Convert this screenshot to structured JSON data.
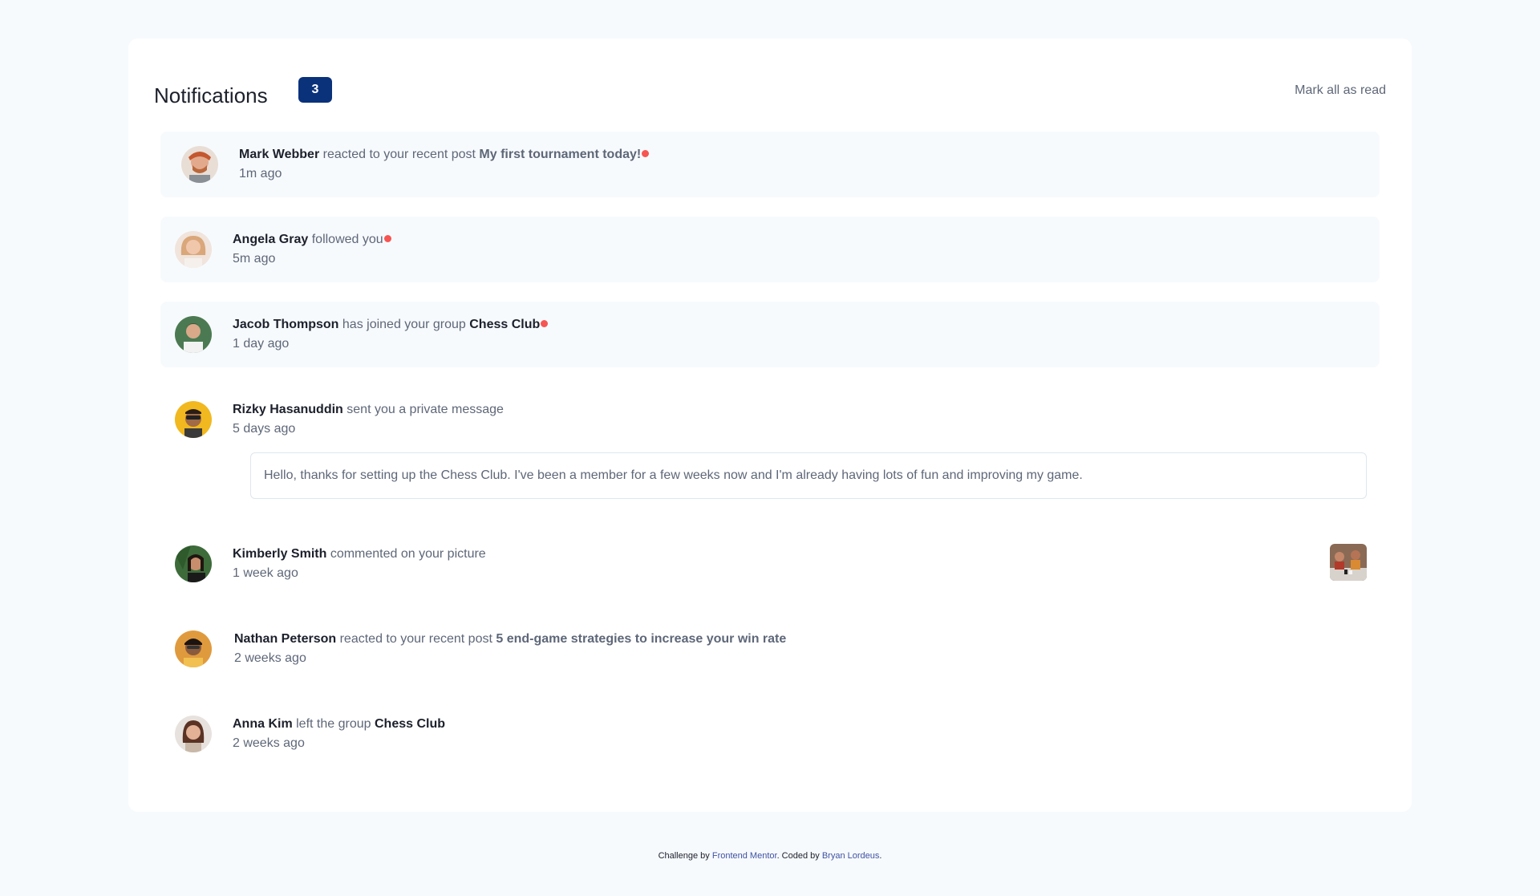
{
  "header": {
    "title": "Notifications",
    "unread_count": "3",
    "mark_all_label": "Mark all as read"
  },
  "notifications": [
    {
      "name": "Mark Webber",
      "action": "reacted to your recent post",
      "target": "My first tournament today!",
      "time": "1m ago",
      "unread": true,
      "avatar": "avatar-mark-webber"
    },
    {
      "name": "Angela Gray",
      "action": "followed you",
      "target": "",
      "time": "5m ago",
      "unread": true,
      "avatar": "avatar-angela-gray"
    },
    {
      "name": "Jacob Thompson",
      "action": "has joined your group",
      "target": "Chess Club",
      "time": "1 day ago",
      "unread": true,
      "avatar": "avatar-jacob-thompson"
    },
    {
      "name": "Rizky Hasanuddin",
      "action": "sent you a private message",
      "target": "",
      "time": "5 days ago",
      "unread": false,
      "avatar": "avatar-rizky-hasanuddin",
      "message": "Hello, thanks for setting up the Chess Club. I've been a member for a few weeks now and I'm already having lots of fun and improving my game."
    },
    {
      "name": "Kimberly Smith",
      "action": "commented on your picture",
      "target": "",
      "time": "1 week ago",
      "unread": false,
      "avatar": "avatar-kimberly-smith",
      "picture": "chess-picture"
    },
    {
      "name": "Nathan Peterson",
      "action": "reacted to your recent post",
      "target": "5 end-game strategies to increase your win rate",
      "time": "2 weeks ago",
      "unread": false,
      "avatar": "avatar-nathan-peterson"
    },
    {
      "name": "Anna Kim",
      "action": "left the group",
      "target": "Chess Club",
      "time": "2 weeks ago",
      "unread": false,
      "avatar": "avatar-anna-kim"
    }
  ],
  "footer": {
    "prefix": "Challenge by",
    "link1": "Frontend Mentor",
    "middle": ". Coded by",
    "link2": "Bryan Lordeus",
    "suffix": "."
  },
  "colors": {
    "unread_dot": "#f65552",
    "badge": "#0a327b",
    "unread_bg": "#f7fafd"
  }
}
